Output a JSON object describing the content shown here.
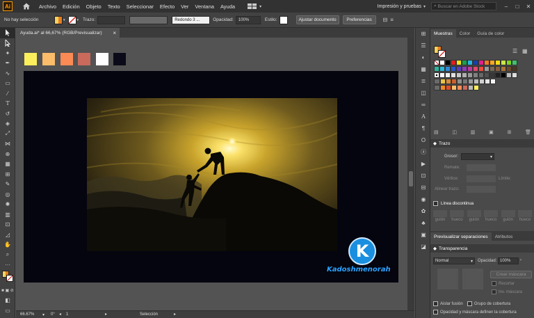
{
  "menubar": {
    "app_logo": "Ai",
    "menus": [
      "Archivo",
      "Edición",
      "Objeto",
      "Texto",
      "Seleccionar",
      "Efecto",
      "Ver",
      "Ventana",
      "Ayuda"
    ],
    "workspace": "Impresión y pruebas",
    "search_placeholder": "Buscar en Adobe Stock"
  },
  "control": {
    "selection_status": "No hay selección",
    "stroke_label": "Trazo:",
    "brush": "Redondo 3 ...",
    "opacity_label": "Opacidad:",
    "opacity_value": "100%",
    "style_label": "Estilo:",
    "adjust_button": "Ajustar documento",
    "prefs_button": "Preferencias"
  },
  "document": {
    "tab_title": "Ayuda.ai* al 66,67% (RGB/Previsualizar)",
    "close": "×",
    "palette": [
      "#fbf05b",
      "#fbbd6a",
      "#fb8a55",
      "#c96a5c",
      "#ffffff",
      "#0a0a18"
    ],
    "artboard_color": "#04050f",
    "watermark": "Kadoshmenorah",
    "watermark_letter": "K"
  },
  "status": {
    "zoom": "66.67%",
    "angle": "0°",
    "artboard": "1",
    "tool": "Selección"
  },
  "panels": {
    "swatches_tabs": [
      "Muestras",
      "Color",
      "Guía de color"
    ],
    "stroke_title": "Trazo",
    "stroke_weight_label": "Grosor:",
    "stroke_labels": [
      "Remate:",
      "Vértice:",
      "Límite:",
      "Alinear trazo:"
    ],
    "dashed_label": "Línea discontinua",
    "dash_labels": [
      "guión",
      "hueco",
      "guión",
      "hueco",
      "guión",
      "hueco"
    ],
    "bottom_tabs": [
      "Previsualizar separaciones",
      "Atributos"
    ],
    "transparency_title": "Transparencia",
    "blend_mode": "Normal",
    "trans_opacity_label": "Opacidad:",
    "trans_opacity_value": "100%",
    "make_mask": "Crear máscara",
    "clip": "Recortar",
    "invert_mask": "Inv. máscara",
    "isolate_blend": "Aislar fusión",
    "knockout_group": "Grupo de cobertura",
    "opacity_mask_define": "Opacidad y máscara definen la cobertura"
  }
}
